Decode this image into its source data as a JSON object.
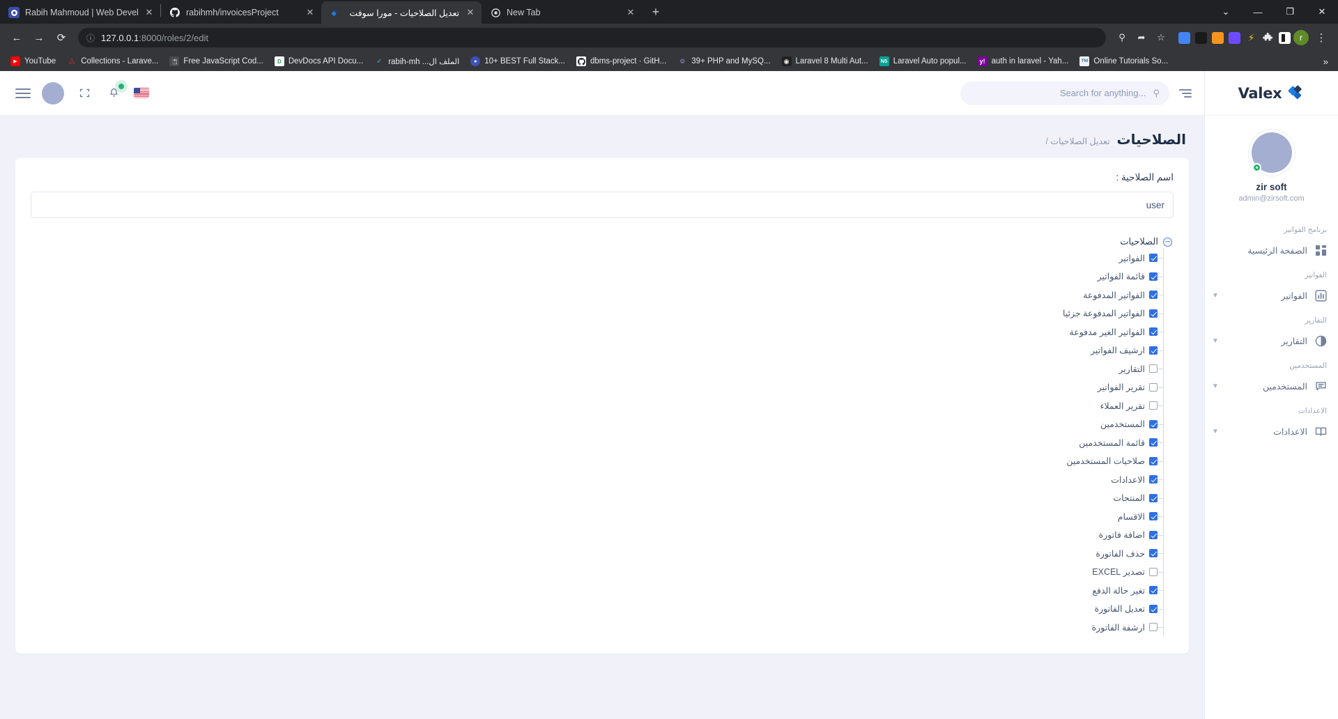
{
  "browser": {
    "tabs": [
      {
        "title": "Rabih Mahmoud | Web Develope",
        "favicon": "globe-icon",
        "rtl": false,
        "active": false
      },
      {
        "title": "rabihmh/invoicesProject",
        "favicon": "github-icon",
        "rtl": false,
        "active": false
      },
      {
        "title": "تعديل الصلاحيات - مورا سوفت للادا",
        "favicon": "valex-icon",
        "rtl": true,
        "active": true
      },
      {
        "title": "New Tab",
        "favicon": "chrome-icon",
        "rtl": false,
        "active": false
      }
    ],
    "new_tab_label": "+",
    "window_controls": [
      "⌄",
      "—",
      "❐",
      "✕"
    ],
    "nav": {
      "back": "←",
      "forward": "→",
      "reload": "⟳"
    },
    "url_prefix": "127.0.0.1",
    "url_suffix": ":8000/roles/2/edit",
    "site_info_icon": "info-circle-icon",
    "omnibox_actions": [
      "search-icon",
      "share-icon",
      "bookmark-star-icon"
    ],
    "extensions": [
      "google-translate-icon",
      "video-downloader-icon",
      "honey-icon",
      "vimium-icon",
      "lightning-icon",
      "puzzle-icon",
      "reader-icon"
    ],
    "profile_initial": "r",
    "menu_icon": "kebab-menu-icon",
    "bookmarks": [
      {
        "label": "YouTube",
        "icon": "youtube-icon",
        "color": "#ff0000"
      },
      {
        "label": "Collections - Larave...",
        "icon": "laravel-icon",
        "color": "#ff2d20"
      },
      {
        "label": "Free JavaScript Cod...",
        "icon": "book-icon",
        "color": "#4a4a4a"
      },
      {
        "label": "DevDocs API Docu...",
        "icon": "devdocs-icon",
        "color": "#2a9e63"
      },
      {
        "label": "rabih-mh ...الملف ال",
        "icon": "feather-icon",
        "color": "#4aa8e0"
      },
      {
        "label": "10+ BEST Full Stack...",
        "icon": "circle-icon",
        "color": "#3f51b5"
      },
      {
        "label": "dbms-project · GitH...",
        "icon": "github-icon",
        "color": "#ffffff"
      },
      {
        "label": "39+ PHP and MySQ...",
        "icon": "php-icon",
        "color": "#6181b6"
      },
      {
        "label": "Laravel 8 Multi Aut...",
        "icon": "globe-icon",
        "color": "#222222"
      },
      {
        "label": "Laravel Auto popul...",
        "icon": "ns-icon",
        "color": "#0aa396"
      },
      {
        "label": "auth in laravel - Yah...",
        "icon": "yahoo-icon",
        "color": "#7b0099"
      },
      {
        "label": "Online Tutorials So...",
        "icon": "tni-icon",
        "color": "#f2f2f2"
      }
    ],
    "bookmarks_overflow": "»"
  },
  "header": {
    "menu_icon": "hamburger-icon",
    "avatar": "user-avatar",
    "fullscreen_icon": "fullscreen-icon",
    "notifications_icon": "bell-icon",
    "language_flag": "us-flag-icon",
    "search": {
      "placeholder": "...Search for anything",
      "value": "",
      "icon": "search-icon"
    },
    "list_icon": "align-right-icon"
  },
  "page": {
    "title": "الصلاحيات",
    "breadcrumb": "تعديل الصلاحيات /",
    "form": {
      "name_label": "اسم الصلاحية :",
      "name_value": "user",
      "name_placeholder": "اسم الصلاحية"
    },
    "tree": {
      "root_label": "الصلاحيات",
      "collapse_icon": "minus-circle-icon",
      "items": [
        {
          "label": "الفواتير",
          "checked": true
        },
        {
          "label": "قائمة الفواتير",
          "checked": true
        },
        {
          "label": "الفواتير المدفوعة",
          "checked": true
        },
        {
          "label": "الفواتير المدفوعة جزئيا",
          "checked": true
        },
        {
          "label": "الفواتير الغير مدفوعة",
          "checked": true
        },
        {
          "label": "ارشيف الفواتير",
          "checked": true
        },
        {
          "label": "التقارير",
          "checked": false
        },
        {
          "label": "تقرير الفواتير",
          "checked": false
        },
        {
          "label": "تقرير العملاء",
          "checked": false
        },
        {
          "label": "المستخدمين",
          "checked": true
        },
        {
          "label": "قائمة المستخدمين",
          "checked": true
        },
        {
          "label": "صلاحيات المستخدمين",
          "checked": true
        },
        {
          "label": "الاعدادات",
          "checked": true
        },
        {
          "label": "المنتجات",
          "checked": true
        },
        {
          "label": "الاقسام",
          "checked": true
        },
        {
          "label": "اضافة فاتورة",
          "checked": true
        },
        {
          "label": "حذف الفاتورة",
          "checked": true
        },
        {
          "label": "تصدير EXCEL",
          "checked": false
        },
        {
          "label": "تغير حالة الدفع",
          "checked": true
        },
        {
          "label": "تعديل الفاتورة",
          "checked": true
        },
        {
          "label": "ارشفة الفاتورة",
          "checked": false
        }
      ]
    }
  },
  "sidebar": {
    "brand": "Valex",
    "brand_icon": "valex-diamond-icon",
    "profile": {
      "name": "zir soft",
      "email": "admin@zirsoft.com",
      "avatar": "profile-avatar",
      "status": "online"
    },
    "sections": [
      {
        "group": "برنامج الفواتير",
        "items": [
          {
            "label": "الصفحة الرئيسية",
            "icon": "grid-icon",
            "chevron": false
          }
        ]
      },
      {
        "group": "الفواتير",
        "items": [
          {
            "label": "الفواتير",
            "icon": "bar-chart-icon",
            "chevron": true
          }
        ]
      },
      {
        "group": "التقارير",
        "items": [
          {
            "label": "التقارير",
            "icon": "pie-chart-icon",
            "chevron": true
          }
        ]
      },
      {
        "group": "المستخدمين",
        "items": [
          {
            "label": "المستخدمين",
            "icon": "chat-icon",
            "chevron": true
          }
        ]
      },
      {
        "group": "الاعدادات",
        "items": [
          {
            "label": "الاعدادات",
            "icon": "book-icon",
            "chevron": true
          }
        ]
      }
    ]
  },
  "colors": {
    "accent": "#2f6fe4",
    "brand_dark": "#25324b",
    "brand_blue": "#3a8fe0",
    "status_green": "#2bb573",
    "page_bg": "#f1f2f9"
  }
}
